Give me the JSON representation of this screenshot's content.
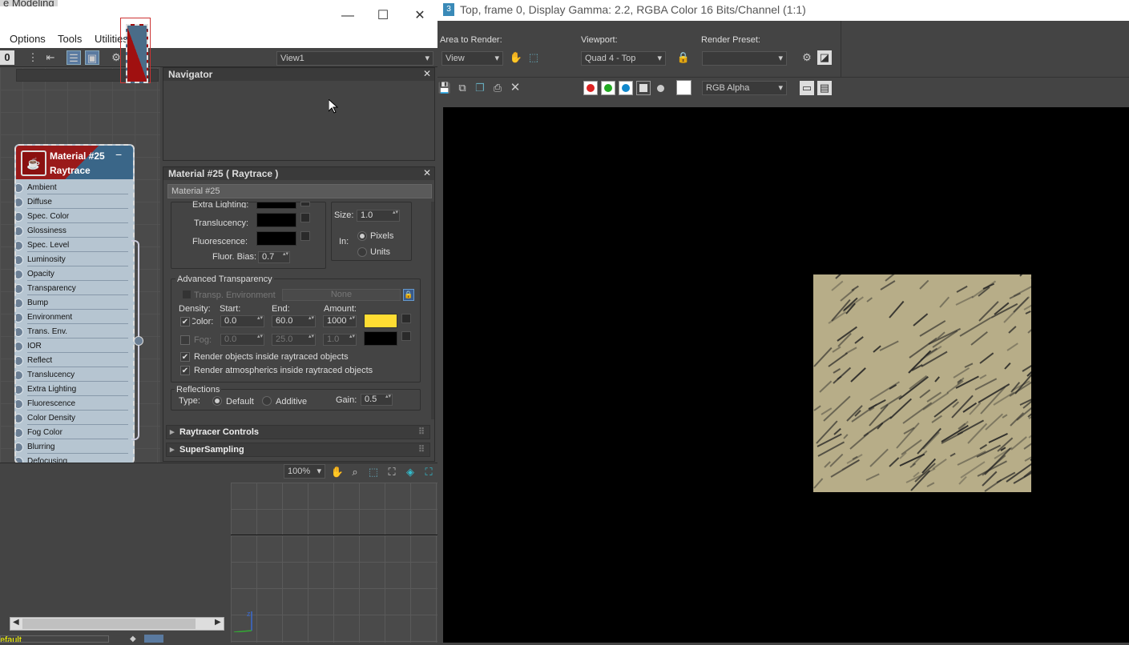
{
  "slate": {
    "bg_title": "e Modeling",
    "menu": [
      "Options",
      "Tools",
      "Utilities"
    ],
    "view_select": "View1",
    "zoom": "100%",
    "status": "efault"
  },
  "node": {
    "title": "Material #25",
    "subtitle": "Raytrace",
    "slots": [
      "Ambient",
      "Diffuse",
      "Spec. Color",
      "Glossiness",
      "Spec. Level",
      "Luminosity",
      "Opacity",
      "Transparency",
      "Bump",
      "Environment",
      "Trans. Env.",
      "IOR",
      "Reflect",
      "Translucency",
      "Extra Lighting",
      "Fluorescence",
      "Color Density",
      "Fog Color",
      "Blurring",
      "Defocusing"
    ]
  },
  "navigator": {
    "title": "Navigator"
  },
  "material": {
    "header": "Material #25  ( Raytrace )",
    "name": "Material #25",
    "extra_lighting": "Extra Lighting:",
    "translucency": "Translucency:",
    "fluorescence": "Fluorescence:",
    "fluor_bias_label": "Fluor. Bias:",
    "fluor_bias": "0.7",
    "size_label": "Size:",
    "size": "1.0",
    "in_label": "In:",
    "pixels": "Pixels",
    "units": "Units",
    "adv_trans": "Advanced Transparency",
    "transp_env": "Transp. Environment",
    "none": "None",
    "density": "Density:",
    "start": "Start:",
    "end": "End:",
    "amount": "Amount:",
    "color_label": "Color:",
    "color_start": "0.0",
    "color_end": "60.0",
    "color_amount": "1000",
    "fog_label": "Fog:",
    "fog_start": "0.0",
    "fog_end": "25.0",
    "fog_amount": "1.0",
    "render_objects": "Render objects inside raytraced objects",
    "render_atmos": "Render atmospherics inside raytraced objects",
    "reflections": "Reflections",
    "type_label": "Type:",
    "default": "Default",
    "additive": "Additive",
    "gain_label": "Gain:",
    "gain": "0.5",
    "rollouts": [
      "Raytracer Controls",
      "SuperSampling"
    ],
    "density_color": "#ffdd33"
  },
  "render": {
    "title": "Top, frame 0, Display Gamma: 2.2, RGBA Color 16 Bits/Channel (1:1)",
    "app_icon": "3",
    "area_label": "Area to Render:",
    "area_value": "View",
    "viewport_label": "Viewport:",
    "viewport_value": "Quad 4 - Top",
    "preset_label": "Render Preset:",
    "preset_value": "",
    "channel": "RGB Alpha",
    "texture_color": "#b7ad88"
  }
}
